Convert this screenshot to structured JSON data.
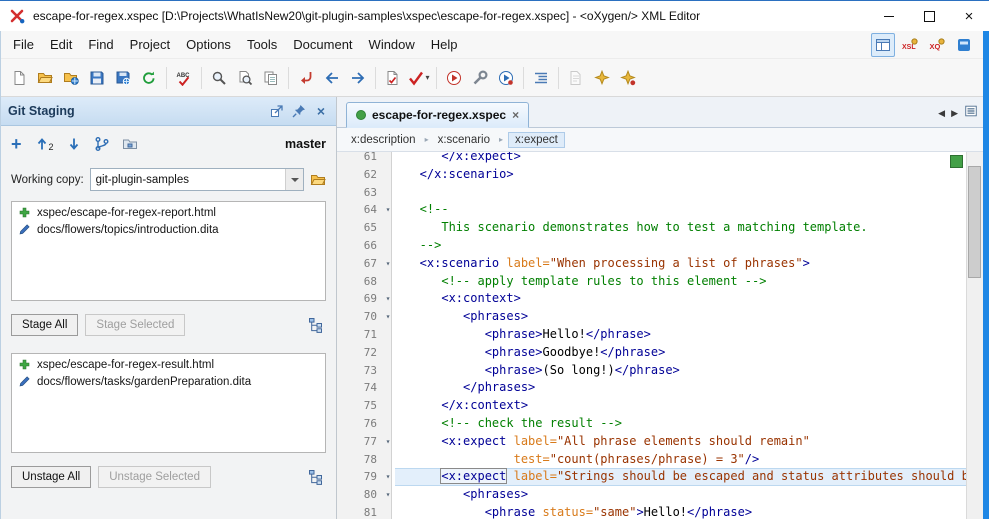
{
  "colors": {
    "accent_blue": "#1e87e5",
    "status_green": "#43a047",
    "added_green": "#3ea743",
    "modified_blue": "#3a6fbf",
    "syntax_tag": "#000096",
    "syntax_attr": "#d87a1a",
    "syntax_value": "#993300",
    "syntax_comment": "#007f00",
    "current_line": "#e3effb"
  },
  "window": {
    "title": "escape-for-regex.xspec [D:\\Projects\\WhatIsNew20\\git-plugin-samples\\xspec\\escape-for-regex.xspec] - <oXygen/> XML Editor"
  },
  "menubar": {
    "items": [
      "File",
      "Edit",
      "Find",
      "Project",
      "Options",
      "Tools",
      "Document",
      "Window",
      "Help"
    ],
    "right_icons": [
      {
        "name": "editor-perspective-icon",
        "active": true
      },
      {
        "name": "xslt-debugger-perspective-icon"
      },
      {
        "name": "xquery-debugger-perspective-icon"
      },
      {
        "name": "layout-icon"
      }
    ]
  },
  "toolbar": {
    "groups": [
      [
        "new-icon",
        "open-icon",
        "open-url-icon",
        "save-icon",
        "save-url-icon",
        "reload-icon"
      ],
      [
        "spell-check-icon"
      ],
      [
        "find-icon",
        "find-in-files-icon",
        "find-resource-icon"
      ],
      [
        "go-to-modification-icon",
        "back-icon",
        "forward-icon"
      ],
      [
        "validate-icon",
        {
          "name": "validate-menu-icon",
          "menu": true
        }
      ],
      [
        "apply-transformation-icon",
        "configure-transformation-icon",
        "debug-transformation-icon"
      ],
      [
        "format-indent-icon"
      ],
      [
        {
          "name": "change-tracking-icon",
          "disabled": true
        },
        "refactoring-icon",
        "quick-fix-icon"
      ]
    ]
  },
  "git_panel": {
    "title": "Git Staging",
    "branch": "master",
    "push_count": "2",
    "header_icons": [
      {
        "name": "float-icon"
      },
      {
        "name": "pin-icon"
      },
      {
        "name": "close-icon"
      }
    ],
    "toolbar_icons": [
      {
        "name": "stage-plus-icon"
      },
      {
        "name": "push-icon",
        "badge": "2"
      },
      {
        "name": "pull-icon"
      },
      {
        "name": "branch-manager-icon"
      },
      {
        "name": "submodules-icon"
      }
    ],
    "working_copy_label": "Working copy:",
    "working_copy_value": "git-plugin-samples",
    "unstaged_files": [
      {
        "status": "added",
        "path": "xspec/escape-for-regex-report.html"
      },
      {
        "status": "modified",
        "path": "docs/flowers/topics/introduction.dita"
      }
    ],
    "staged_files": [
      {
        "status": "added",
        "path": "xspec/escape-for-regex-result.html"
      },
      {
        "status": "modified",
        "path": "docs/flowers/tasks/gardenPreparation.dita"
      }
    ],
    "buttons": {
      "stage_all": "Stage All",
      "stage_selected": "Stage Selected",
      "unstage_all": "Unstage All",
      "unstage_selected": "Unstage Selected"
    }
  },
  "editor": {
    "tab": {
      "label": "escape-for-regex.xspec"
    },
    "breadcrumb": [
      "x:description",
      "x:scenario",
      "x:expect"
    ],
    "lines": [
      {
        "n": "61",
        "fold": false,
        "segs": [
          [
            "tag",
            "      </x:expect>"
          ]
        ]
      },
      {
        "n": "62",
        "fold": false,
        "segs": [
          [
            "tag",
            "   </x:scenario>"
          ]
        ]
      },
      {
        "n": "63",
        "fold": false,
        "segs": []
      },
      {
        "n": "64",
        "fold": true,
        "segs": [
          [
            "com",
            "   <!--"
          ]
        ]
      },
      {
        "n": "65",
        "fold": false,
        "segs": [
          [
            "com",
            "      This scenario demonstrates how to test a matching template."
          ]
        ]
      },
      {
        "n": "66",
        "fold": false,
        "segs": [
          [
            "com",
            "   -->"
          ]
        ]
      },
      {
        "n": "67",
        "fold": true,
        "segs": [
          [
            "tag",
            "   <x:scenario "
          ],
          [
            "attr",
            "label="
          ],
          [
            "val",
            "\"When processing a list of phrases\""
          ],
          [
            "tag",
            ">"
          ]
        ]
      },
      {
        "n": "68",
        "fold": false,
        "segs": [
          [
            "com",
            "      <!-- apply template rules to this element -->"
          ]
        ]
      },
      {
        "n": "69",
        "fold": true,
        "segs": [
          [
            "tag",
            "      <x:context>"
          ]
        ]
      },
      {
        "n": "70",
        "fold": true,
        "segs": [
          [
            "tag",
            "         <phrases>"
          ]
        ]
      },
      {
        "n": "71",
        "fold": false,
        "segs": [
          [
            "tag",
            "            <phrase>"
          ],
          [
            "txt",
            "Hello!"
          ],
          [
            "tag",
            "</phrase>"
          ]
        ]
      },
      {
        "n": "72",
        "fold": false,
        "segs": [
          [
            "tag",
            "            <phrase>"
          ],
          [
            "txt",
            "Goodbye!"
          ],
          [
            "tag",
            "</phrase>"
          ]
        ]
      },
      {
        "n": "73",
        "fold": false,
        "segs": [
          [
            "tag",
            "            <phrase>"
          ],
          [
            "txt",
            "(So long!)"
          ],
          [
            "tag",
            "</phrase>"
          ]
        ]
      },
      {
        "n": "74",
        "fold": false,
        "segs": [
          [
            "tag",
            "         </phrases>"
          ]
        ]
      },
      {
        "n": "75",
        "fold": false,
        "segs": [
          [
            "tag",
            "      </x:context>"
          ]
        ]
      },
      {
        "n": "76",
        "fold": false,
        "segs": [
          [
            "com",
            "      <!-- check the result -->"
          ]
        ]
      },
      {
        "n": "77",
        "fold": true,
        "segs": [
          [
            "tag",
            "      <x:expect "
          ],
          [
            "attr",
            "label="
          ],
          [
            "val",
            "\"All phrase elements should remain\""
          ]
        ]
      },
      {
        "n": "78",
        "fold": false,
        "segs": [
          [
            "attr",
            "                test="
          ],
          [
            "val",
            "\"count(phrases/phrase) = 3\""
          ],
          [
            "tag",
            "/>"
          ]
        ]
      },
      {
        "n": "79",
        "fold": true,
        "hl": true,
        "segs": [
          [
            "tag",
            "      "
          ],
          [
            "tagbox",
            "<x:expect"
          ],
          [
            "tag",
            " "
          ],
          [
            "attr",
            "label="
          ],
          [
            "val",
            "\"Strings should be escaped and status attributes should be added\""
          ],
          [
            "tag",
            ">"
          ]
        ]
      },
      {
        "n": "80",
        "fold": true,
        "segs": [
          [
            "tag",
            "         <phrases>"
          ]
        ]
      },
      {
        "n": "81",
        "fold": false,
        "segs": [
          [
            "tag",
            "            <phrase "
          ],
          [
            "attr",
            "status="
          ],
          [
            "val",
            "\"same\""
          ],
          [
            "tag",
            ">"
          ],
          [
            "txt",
            "Hello!"
          ],
          [
            "tag",
            "</phrase>"
          ]
        ]
      }
    ]
  }
}
